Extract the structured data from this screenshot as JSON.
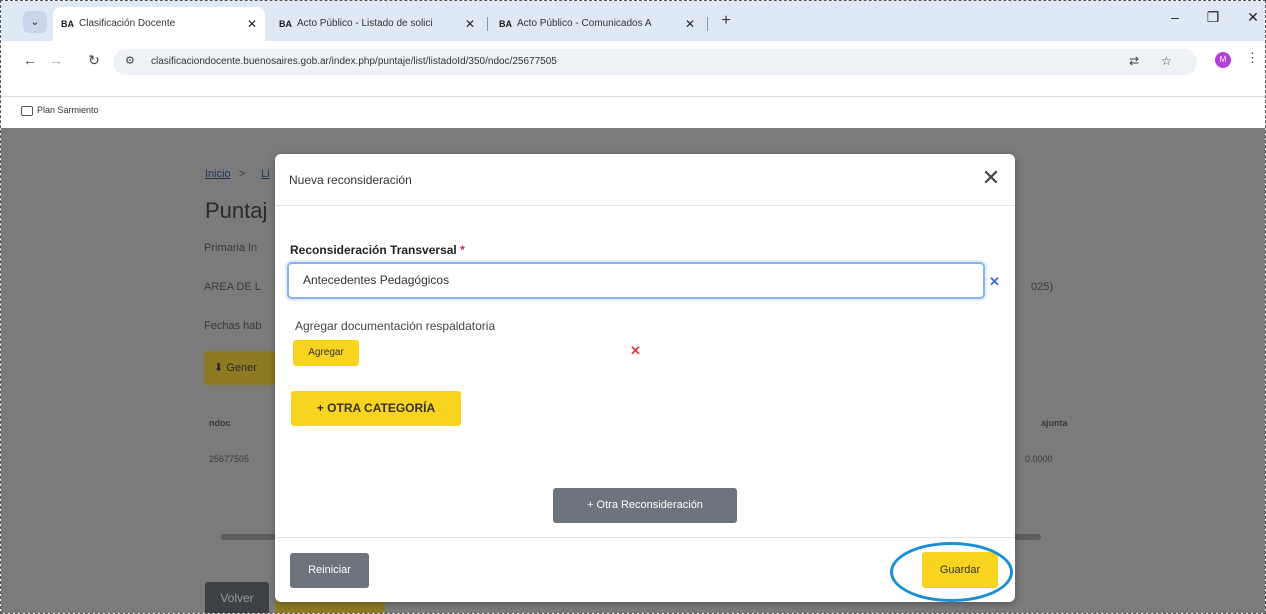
{
  "browser": {
    "tabs": [
      {
        "favicon": "BA",
        "title": "Clasificación Docente",
        "active": true
      },
      {
        "favicon": "BA",
        "title": "Acto Público - Listado de solici",
        "active": false
      },
      {
        "favicon": "BA",
        "title": "Acto Público - Comunicados A",
        "active": false
      }
    ],
    "new_tab": "+",
    "url": "clasificaciondocente.buenosaires.gob.ar/index.php/puntaje/list/listadoId/350/ndoc/25677505",
    "bookmark": "Plan Sarmiento",
    "profile_initial": "M"
  },
  "background_page": {
    "breadcrumb_home": "Inicio",
    "breadcrumb_sep": ">",
    "breadcrumb_next": "Li",
    "title": "Puntaj",
    "line1": "Primaria In",
    "line2": "AREA DE L",
    "line2_suffix": "025)",
    "line3": "Fechas hab",
    "generate_btn": "Gener",
    "table_header_left": "ndoc",
    "table_header_right": "ajunta",
    "table_cell_left": "25677505",
    "table_cell_right": "0.0000",
    "back_btn": "Volver"
  },
  "modal": {
    "title": "Nueva reconsideración",
    "field_label": "Reconsideración Transversal",
    "required_mark": "*",
    "selected_value": "Antecedentes Pedagógicos",
    "doc_label": "Agregar documentación respaldatoria",
    "add_button": "Agregar",
    "other_category_button": "+ OTRA CATEGORÍA",
    "other_reconsideration_button": "+ Otra Reconsideración",
    "reset_button": "Reiniciar",
    "save_button": "Guardar"
  },
  "colors": {
    "primary_yellow": "#f8d320",
    "secondary_gray": "#6c757d",
    "highlight_ring": "#1b8fd6",
    "error_red": "#e03b3b"
  }
}
